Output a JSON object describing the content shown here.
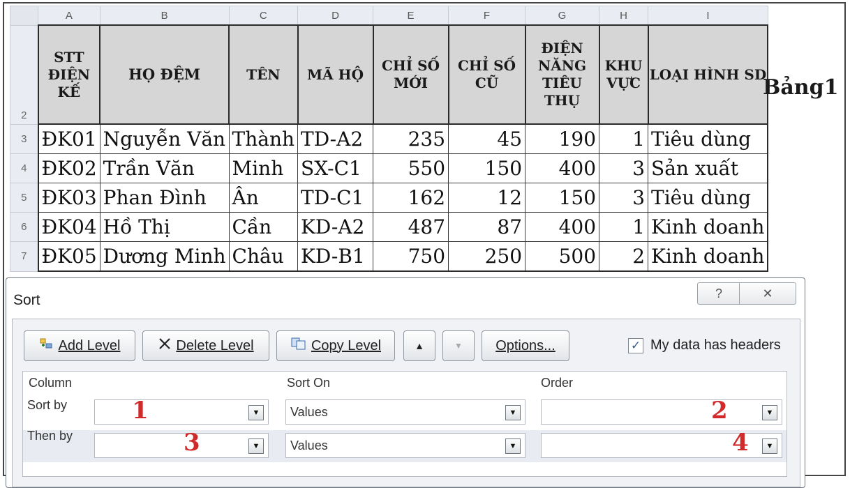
{
  "sheet": {
    "column_headers": [
      "A",
      "B",
      "C",
      "D",
      "E",
      "F",
      "G",
      "H",
      "I"
    ],
    "header_row_number": "2",
    "headers": {
      "stt": "STT ĐIỆN KẾ",
      "ho_dem": "HỌ ĐỆM",
      "ten": "TÊN",
      "ma_ho": "MÃ HỘ",
      "chi_so_moi": "CHỈ SỐ MỚI",
      "chi_so_cu": "CHỈ SỐ CŨ",
      "dien_nang": "ĐIỆN NĂNG TIÊU THỤ",
      "khu_vuc": "KHU VỰC",
      "loai_hinh": "LOẠI HÌNH SD"
    },
    "rows": [
      {
        "row": "3",
        "stt": "ĐK01",
        "ho_dem": "Nguyễn Văn",
        "ten": "Thành",
        "ma_ho": "TD-A2",
        "moi": "235",
        "cu": "45",
        "tieu_thu": "190",
        "khu_vuc": "1",
        "loai": "Tiêu dùng"
      },
      {
        "row": "4",
        "stt": "ĐK02",
        "ho_dem": "Trần Văn",
        "ten": "Minh",
        "ma_ho": "SX-C1",
        "moi": "550",
        "cu": "150",
        "tieu_thu": "400",
        "khu_vuc": "3",
        "loai": "Sản xuất"
      },
      {
        "row": "5",
        "stt": "ĐK03",
        "ho_dem": "Phan Đình",
        "ten": "Ân",
        "ma_ho": "TD-C1",
        "moi": "162",
        "cu": "12",
        "tieu_thu": "150",
        "khu_vuc": "3",
        "loai": "Tiêu dùng"
      },
      {
        "row": "6",
        "stt": "ĐK04",
        "ho_dem": "Hồ Thị",
        "ten": "Cần",
        "ma_ho": "KD-A2",
        "moi": "487",
        "cu": "87",
        "tieu_thu": "400",
        "khu_vuc": "1",
        "loai": "Kinh doanh"
      },
      {
        "row": "7",
        "stt": "ĐK05",
        "ho_dem": "Dương Minh",
        "ten": "Châu",
        "ma_ho": "KD-B1",
        "moi": "750",
        "cu": "250",
        "tieu_thu": "500",
        "khu_vuc": "2",
        "loai": "Kinh doanh"
      }
    ],
    "table_label": "Bảng1"
  },
  "dialog": {
    "title": "Sort",
    "help_glyph": "?",
    "close_glyph": "✕",
    "toolbar": {
      "add_level": "Add Level",
      "delete_level": "Delete Level",
      "copy_level": "Copy Level",
      "move_up_glyph": "▲",
      "move_down_glyph": "▼",
      "options": "Options...",
      "my_data_has_headers": "My data has headers",
      "headers_checked": true
    },
    "columns": {
      "column": "Column",
      "sort_on": "Sort On",
      "order": "Order"
    },
    "levels": [
      {
        "label": "Sort by",
        "column_value": "",
        "sort_on": "Values",
        "order": "",
        "marker_column": "1",
        "marker_order": "2"
      },
      {
        "label": "Then by",
        "column_value": "",
        "sort_on": "Values",
        "order": "",
        "marker_column": "3",
        "marker_order": "4"
      }
    ]
  },
  "icons": {
    "add_level": "add-level-icon",
    "delete_level": "delete-x-icon",
    "copy_level": "copy-icon",
    "dropdown": "chevron-down-icon",
    "checkbox": "checkmark-icon"
  }
}
